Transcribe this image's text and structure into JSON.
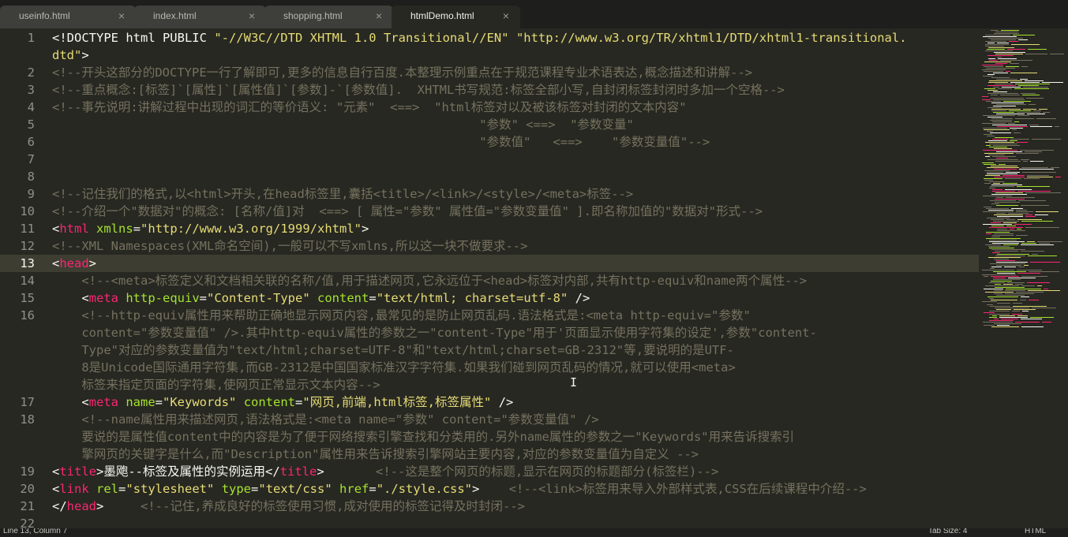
{
  "tabs": [
    {
      "label": "useinfo.html",
      "close": "×",
      "active": false
    },
    {
      "label": "index.html",
      "close": "×",
      "active": false
    },
    {
      "label": "shopping.html",
      "close": "×",
      "active": false
    },
    {
      "label": "htmlDemo.html",
      "close": "×",
      "active": true
    }
  ],
  "editor": {
    "current_line": 13,
    "lines": [
      {
        "n": "1",
        "segs": [
          [
            "p",
            "<!DOCTYPE html PUBLIC "
          ],
          [
            "s",
            "\"-//W3C//DTD XHTML 1.0 Transitional//EN\""
          ],
          [
            "p",
            " "
          ],
          [
            "s",
            "\"http://www.w3.org/TR/xhtml1/DTD/xhtml1-transitional."
          ]
        ]
      },
      {
        "n": "",
        "segs": [
          [
            "s",
            "dtd\""
          ],
          [
            "p",
            ">"
          ]
        ]
      },
      {
        "n": "2",
        "segs": [
          [
            "c",
            "<!--开头这部分的DOCTYPE一行了解即可,更多的信息自行百度.本整理示例重点在于规范课程专业术语表达,概念描述和讲解-->"
          ]
        ]
      },
      {
        "n": "3",
        "segs": [
          [
            "c",
            "<!--重点概念:[标签]`[属性]`[属性值]`[参数]-`[参数值].  XHTML书写规范:标签全部小写,自封闭标签封闭时多加一个空格-->"
          ]
        ]
      },
      {
        "n": "4",
        "segs": [
          [
            "c",
            "<!--事先说明:讲解过程中出现的词汇的等价语义: \"元素\"  <==>  \"html标签对以及被该标签对封闭的文本内容\""
          ]
        ]
      },
      {
        "n": "5",
        "segs": [
          [
            "c",
            "                                                          \"参数\" <==>  \"参数变量\""
          ]
        ]
      },
      {
        "n": "6",
        "segs": [
          [
            "c",
            "                                                          \"参数值\"   <==>    \"参数变量值\"-->"
          ]
        ]
      },
      {
        "n": "7",
        "segs": []
      },
      {
        "n": "8",
        "segs": []
      },
      {
        "n": "9",
        "segs": [
          [
            "c",
            "<!--记住我们的格式,以<html>开头,在head标签里,囊括<title>/<link>/<style>/<meta>标签-->"
          ]
        ]
      },
      {
        "n": "10",
        "segs": [
          [
            "c",
            "<!--介绍一个\"数据对\"的概念: [名称/值]对  <==> [ 属性=\"参数\" 属性值=\"参数变量值\" ].即名称加值的\"数据对\"形式-->"
          ]
        ]
      },
      {
        "n": "11",
        "segs": [
          [
            "p",
            "<"
          ],
          [
            "t",
            "html"
          ],
          [
            "p",
            " "
          ],
          [
            "a",
            "xmlns"
          ],
          [
            "p",
            "="
          ],
          [
            "s",
            "\"http://www.w3.org/1999/xhtml\""
          ],
          [
            "p",
            ">"
          ]
        ]
      },
      {
        "n": "12",
        "segs": [
          [
            "c",
            "<!--XML Namespaces(XML命名空间),一般可以不写xmlns,所以这一块不做要求-->"
          ]
        ]
      },
      {
        "n": "13",
        "segs": [
          [
            "p",
            "<"
          ],
          [
            "t",
            "head"
          ],
          [
            "p",
            ">"
          ]
        ]
      },
      {
        "n": "14",
        "segs": [
          [
            "p",
            "    "
          ],
          [
            "c",
            "<!--<meta>标签定义和文档相关联的名称/值,用于描述网页,它永远位于<head>标签对内部,共有http-equiv和name两个属性-->"
          ]
        ]
      },
      {
        "n": "15",
        "segs": [
          [
            "p",
            "    <"
          ],
          [
            "t",
            "meta"
          ],
          [
            "p",
            " "
          ],
          [
            "a",
            "http-equiv"
          ],
          [
            "p",
            "="
          ],
          [
            "s",
            "\"Content-Type\""
          ],
          [
            "p",
            " "
          ],
          [
            "a",
            "content"
          ],
          [
            "p",
            "="
          ],
          [
            "s",
            "\"text/html; charset=utf-8\""
          ],
          [
            "p",
            " />"
          ]
        ]
      },
      {
        "n": "16",
        "segs": [
          [
            "p",
            "    "
          ],
          [
            "c",
            "<!--http-equiv属性用来帮助正确地显示网页内容,最常见的是防止网页乱码.语法格式是:<meta http-equiv=\"参数\""
          ]
        ]
      },
      {
        "n": "",
        "segs": [
          [
            "c",
            "    content=\"参数变量值\" />.其中http-equiv属性的参数之一\"content-Type\"用于'页面显示使用字符集的设定',参数\"content-"
          ]
        ]
      },
      {
        "n": "",
        "segs": [
          [
            "c",
            "    Type\"对应的参数变量值为\"text/html;charset=UTF-8\"和\"text/html;charset=GB-2312\"等,要说明的是UTF-"
          ]
        ]
      },
      {
        "n": "",
        "segs": [
          [
            "c",
            "    8是Unicode国际通用字符集,而GB-2312是中国国家标准汉字字符集.如果我们碰到网页乱码的情况,就可以使用<meta>"
          ]
        ]
      },
      {
        "n": "",
        "segs": [
          [
            "c",
            "    标签来指定页面的字符集,使网页正常显示文本内容-->"
          ]
        ]
      },
      {
        "n": "17",
        "segs": [
          [
            "p",
            "    <"
          ],
          [
            "t",
            "meta"
          ],
          [
            "p",
            " "
          ],
          [
            "a",
            "name"
          ],
          [
            "p",
            "="
          ],
          [
            "s",
            "\"Keywords\""
          ],
          [
            "p",
            " "
          ],
          [
            "a",
            "content"
          ],
          [
            "p",
            "="
          ],
          [
            "s",
            "\"网页,前端,html标签,标签属性\""
          ],
          [
            "p",
            " />"
          ]
        ]
      },
      {
        "n": "18",
        "segs": [
          [
            "p",
            "    "
          ],
          [
            "c",
            "<!--name属性用来描述网页,语法格式是:<meta name=\"参数\" content=\"参数变量值\" />"
          ]
        ]
      },
      {
        "n": "",
        "segs": [
          [
            "c",
            "    要说的是属性值content中的内容是为了便于网络搜索引擎查找和分类用的.另外name属性的参数之一\"Keywords\"用来告诉搜索引"
          ]
        ]
      },
      {
        "n": "",
        "segs": [
          [
            "c",
            "    擎网页的关键字是什么,而\"Description\"属性用来告诉搜索引擎网站主要内容,对应的参数变量值为自定义 -->"
          ]
        ]
      },
      {
        "n": "19",
        "segs": [
          [
            "p",
            "<"
          ],
          [
            "t",
            "title"
          ],
          [
            "p",
            ">墨飑--标签及属性的实例运用</"
          ],
          [
            "t",
            "title"
          ],
          [
            "p",
            ">       "
          ],
          [
            "c",
            "<!--这是整个网页的标题,显示在网页的标题部分(标签栏)-->"
          ]
        ]
      },
      {
        "n": "20",
        "segs": [
          [
            "p",
            "<"
          ],
          [
            "t",
            "link"
          ],
          [
            "p",
            " "
          ],
          [
            "a",
            "rel"
          ],
          [
            "p",
            "="
          ],
          [
            "s",
            "\"stylesheet\""
          ],
          [
            "p",
            " "
          ],
          [
            "a",
            "type"
          ],
          [
            "p",
            "="
          ],
          [
            "s",
            "\"text/css\""
          ],
          [
            "p",
            " "
          ],
          [
            "a",
            "href"
          ],
          [
            "p",
            "="
          ],
          [
            "s",
            "\"./style.css\""
          ],
          [
            "p",
            ">    "
          ],
          [
            "c",
            "<!--<link>标签用来导入外部样式表,CSS在后续课程中介绍-->"
          ]
        ]
      },
      {
        "n": "21",
        "segs": [
          [
            "p",
            "</"
          ],
          [
            "t",
            "head"
          ],
          [
            "p",
            ">     "
          ],
          [
            "c",
            "<!--记住,养成良好的标签使用习惯,成对使用的标签记得及时封闭-->"
          ]
        ]
      },
      {
        "n": "22",
        "segs": []
      }
    ]
  },
  "status": {
    "position": "Line 13, Column 7",
    "tab_size": "Tab Size: 4",
    "syntax": "HTML"
  },
  "colors": {
    "background": "#272822",
    "tag": "#f92672",
    "attribute": "#a6e22e",
    "string": "#e6db74",
    "comment": "#75715e",
    "text": "#f8f8f2"
  }
}
